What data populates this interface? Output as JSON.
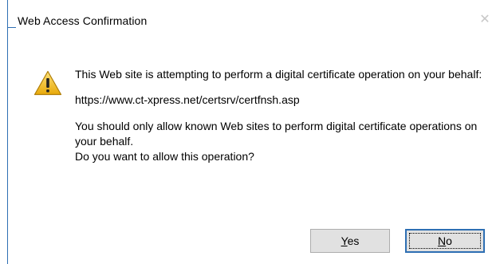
{
  "window": {
    "title": "Web Access Confirmation",
    "close_glyph": "✕"
  },
  "message": {
    "icon": "warning-icon",
    "line1": "This Web site is attempting to perform a digital certificate operation on your behalf:",
    "url": "https://www.ct-xpress.net/certsrv/certfnsh.asp",
    "line2": "You should only allow known Web sites to perform digital certificate operations on your behalf.",
    "line3": "Do you want to allow this operation?"
  },
  "buttons": {
    "yes_accel": "Y",
    "yes_rest": "es",
    "no_accel": "N",
    "no_rest": "o"
  },
  "colors": {
    "accent": "#2e6fb3",
    "warning_fill": "#f5c518",
    "button_face": "#e1e1e1"
  }
}
